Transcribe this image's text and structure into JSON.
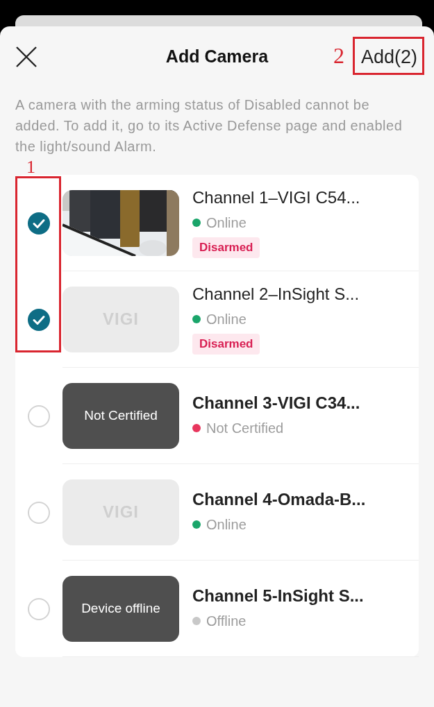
{
  "header": {
    "title": "Add Camera",
    "action": "Add(2)"
  },
  "notice": "A camera with the arming status of Disabled cannot be added. To add it, go to its Active Defense page and enabled the light/sound Alarm.",
  "annotations": [
    {
      "label": "1",
      "kind": "column"
    },
    {
      "label": "2",
      "kind": "header"
    }
  ],
  "cameras": [
    {
      "name": "Channel 1–VIGI C54...",
      "bold": false,
      "checked": true,
      "status": {
        "label": "Online",
        "color": "#1aa56a"
      },
      "tag": "Disarmed"
    },
    {
      "name": "Channel 2–InSight S...",
      "bold": false,
      "checked": true,
      "thumb": {
        "kind": "logo",
        "logo": "VIGI"
      },
      "status": {
        "label": "Online",
        "color": "#1aa56a"
      },
      "tag": "Disarmed"
    },
    {
      "name": "Channel 3-VIGI C34...",
      "bold": true,
      "checked": false,
      "thumb": {
        "kind": "overlay",
        "text": "Not Certified"
      },
      "status": {
        "label": "Not Certified",
        "color": "#e8365d"
      }
    },
    {
      "name": "Channel 4-Omada-B...",
      "bold": true,
      "checked": false,
      "thumb": {
        "kind": "logo",
        "logo": "VIGI"
      },
      "status": {
        "label": "Online",
        "color": "#1aa56a"
      }
    },
    {
      "name": "Channel 5-InSight S...",
      "bold": true,
      "checked": false,
      "thumb": {
        "kind": "overlay",
        "text": "Device offline"
      },
      "status": {
        "label": "Offline",
        "color": "#c8c8c8"
      }
    }
  ]
}
